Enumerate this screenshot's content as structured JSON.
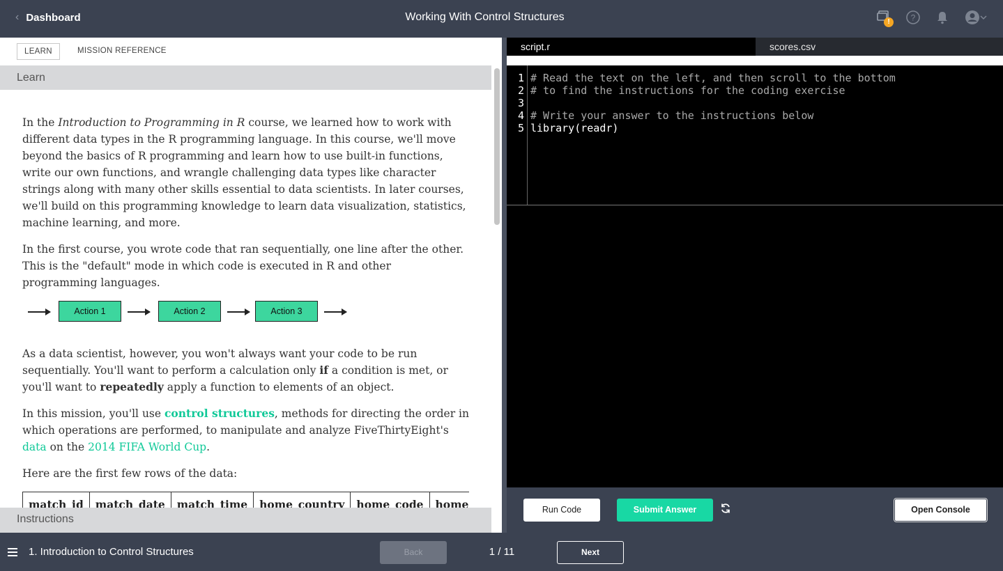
{
  "header": {
    "back_label": "Dashboard",
    "title": "Working With Control Structures",
    "icons": [
      "chat-icon",
      "help-icon",
      "bell-icon",
      "user-avatar-icon",
      "chevron-down-icon"
    ],
    "warning_badge": "!"
  },
  "left": {
    "tabs": [
      {
        "label": "LEARN",
        "active": true
      },
      {
        "label": "MISSION REFERENCE",
        "active": false
      }
    ],
    "section_learn": "Learn",
    "section_instructions": "Instructions",
    "p1": {
      "t1": "In the ",
      "em": "Introduction to Programming in R",
      "t2": " course, we learned how to work with different data types in the R programming language. In this course, we'll move beyond the basics of R programming and learn how to use built-in functions, write our own functions, and wrangle challenging data types like character strings along with many other skills essential to data scientists. In later courses, we'll build on this programming knowledge to learn data visualization, statistics, machine learning, and more."
    },
    "p2": "In the first course, you wrote code that ran sequentially, one line after the other. This is the \"default\" mode in which code is executed in R and other programming languages.",
    "flow": [
      "Action 1",
      "Action 2",
      "Action 3"
    ],
    "p3": {
      "t1": "As a data scientist, however, you won't always want your code to be run sequentially. You'll want to perform a calculation only ",
      "b1": "if",
      "t2": " a condition is met, or you'll want to ",
      "b2": "repeatedly",
      "t3": " apply a function to elements of an object."
    },
    "p4": {
      "t1": "In this mission, you'll use ",
      "link1": "control structures",
      "t2": ", methods for directing the order in which operations are performed, to manipulate and analyze FiveThirtyEight's ",
      "link2": "data",
      "t3": " on the ",
      "link3": "2014 FIFA World Cup",
      "t4": "."
    },
    "p5": "Here are the first few rows of the data:",
    "table_headers": [
      "match_id",
      "match_date",
      "match_time",
      "home_country",
      "home_code",
      "home_goa"
    ]
  },
  "editor": {
    "files": [
      {
        "name": "script.r",
        "active": true
      },
      {
        "name": "scores.csv",
        "active": false
      }
    ],
    "lines": [
      {
        "no": "1",
        "text": "# Read the text on the left, and then scroll to the bottom",
        "kind": "comment"
      },
      {
        "no": "2",
        "text": "# to find the instructions for the coding exercise",
        "kind": "comment"
      },
      {
        "no": "3",
        "text": "",
        "kind": "comment"
      },
      {
        "no": "4",
        "text": "# Write your answer to the instructions below",
        "kind": "comment"
      },
      {
        "no": "5",
        "text": "library(readr)",
        "kind": "code"
      }
    ],
    "run_label": "Run Code",
    "submit_label": "Submit Answer",
    "console_label": "Open Console"
  },
  "footer": {
    "lesson": "1. Introduction to Control Structures",
    "back_label": "Back",
    "pager": "1 / 11",
    "next_label": "Next"
  },
  "colors": {
    "accent": "#18d8a4",
    "header_bg": "#3b4251",
    "link": "#10c998",
    "flow_box": "#3dd69e"
  }
}
